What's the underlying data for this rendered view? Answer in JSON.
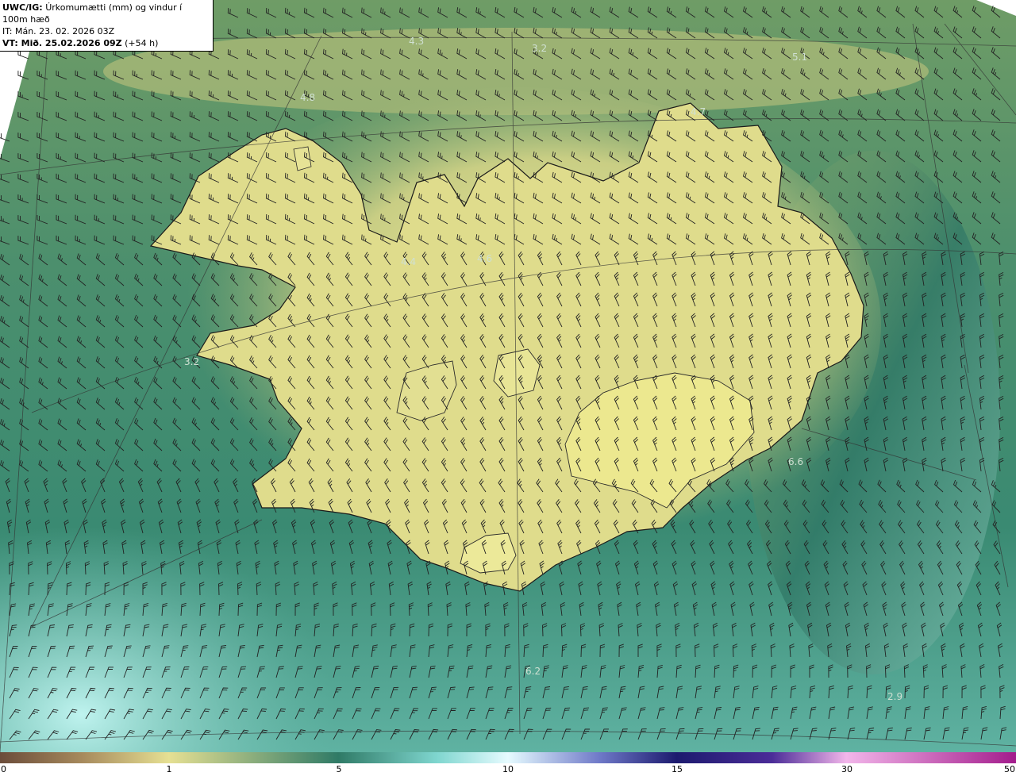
{
  "header": {
    "model": "UWC/IG:",
    "description": "Úrkomumætti (mm) og vindur í 100m hæð",
    "issue_time": "IT: Mán. 23. 02. 2026 03Z",
    "valid_prefix": "VT: Mið. 25.02.2026 09Z",
    "valid_suffix": "(+54 h)"
  },
  "value_labels": [
    "4.3",
    "3.2",
    "5.1",
    "4.8",
    "4.7",
    "4.4",
    "4.6",
    "3.2",
    "6.6",
    "6.2",
    "2.9"
  ],
  "colorbar": {
    "ticks": [
      "0",
      "1",
      "5",
      "10",
      "15",
      "30",
      "50"
    ],
    "colors": [
      "#6b4c3a",
      "#a6895c",
      "#e6e093",
      "#2f7a66",
      "#7fd6cf",
      "#e6fbff",
      "#1c1a6e",
      "#4b2c98",
      "#b866c4",
      "#f2b6ea",
      "#a31c8c"
    ]
  },
  "colors": {
    "land": "#e3e08c",
    "ocean_deep": "#2e7363",
    "ocean_mid": "#4a9470",
    "ocean_light": "#7fc7bb",
    "coastline": "#1a1a1a",
    "barb": "#222222"
  }
}
